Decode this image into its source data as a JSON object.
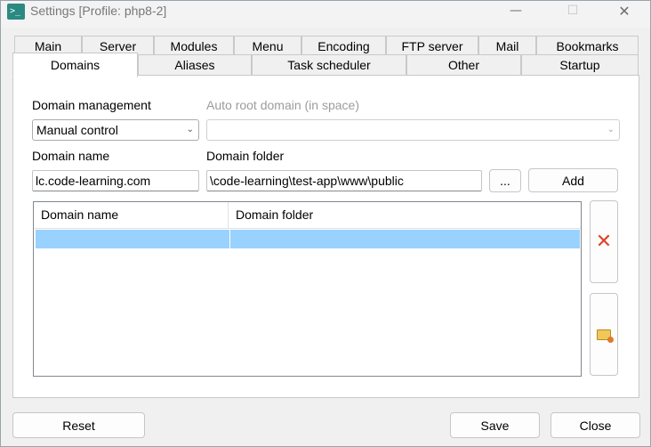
{
  "window": {
    "title": "Settings [Profile: php8-2]",
    "app_icon_text": ">_"
  },
  "tabs_row1": [
    "Main",
    "Server",
    "Modules",
    "Menu",
    "Encoding",
    "FTP server",
    "Mail",
    "Bookmarks"
  ],
  "tabs_row2": [
    "Domains",
    "Aliases",
    "Task scheduler",
    "Other",
    "Startup"
  ],
  "active_tab": "Domains",
  "form": {
    "domain_management_label": "Domain management",
    "domain_management_value": "Manual control",
    "auto_root_label": "Auto root domain (in space)",
    "auto_root_value": "",
    "domain_name_label": "Domain name",
    "domain_name_value": "lc.code-learning.com",
    "domain_folder_label": "Domain folder",
    "domain_folder_value": "\\code-learning\\test-app\\www\\public",
    "browse_label": "...",
    "add_label": "Add"
  },
  "list": {
    "columns": [
      "Domain name",
      "Domain folder"
    ],
    "rows": [
      {
        "domain_name": "",
        "domain_folder": ""
      }
    ]
  },
  "side_buttons": {
    "delete_icon": "delete-x-icon",
    "folder_icon": "folder-open-icon"
  },
  "footer": {
    "reset_label": "Reset",
    "save_label": "Save",
    "close_label": "Close"
  },
  "colors": {
    "selection": "#99d1ff",
    "delete": "#e0432a",
    "app_icon": "#2a8a82"
  }
}
